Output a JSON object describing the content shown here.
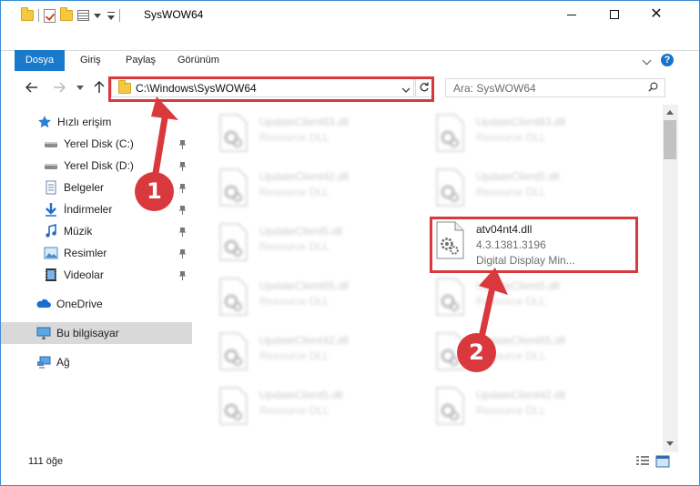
{
  "window": {
    "title": "SysWOW64",
    "buttons": {
      "minimize": "–",
      "maximize": "☐",
      "close": "✕"
    }
  },
  "ribbon": {
    "tabs": [
      "Dosya",
      "Giriş",
      "Paylaş",
      "Görünüm"
    ],
    "help_label": "?"
  },
  "navbar": {
    "address": "C:\\Windows\\SysWOW64",
    "search_placeholder": "Ara: SysWOW64"
  },
  "sidebar": {
    "items": [
      {
        "label": "Hızlı erişim",
        "icon": "star-icon",
        "pinned": false
      },
      {
        "label": "Yerel Disk (C:)",
        "icon": "drive-icon",
        "pinned": true
      },
      {
        "label": "Yerel Disk (D:)",
        "icon": "drive-icon",
        "pinned": true
      },
      {
        "label": "Belgeler",
        "icon": "documents-icon",
        "pinned": true
      },
      {
        "label": "İndirmeler",
        "icon": "download-icon",
        "pinned": true
      },
      {
        "label": "Müzik",
        "icon": "music-icon",
        "pinned": true
      },
      {
        "label": "Resimler",
        "icon": "pictures-icon",
        "pinned": true
      },
      {
        "label": "Videolar",
        "icon": "videos-icon",
        "pinned": true
      },
      {
        "label": "OneDrive",
        "icon": "cloud-icon",
        "pinned": false
      },
      {
        "label": "Bu bilgisayar",
        "icon": "computer-icon",
        "pinned": false
      },
      {
        "label": "Ağ",
        "icon": "network-icon",
        "pinned": false
      }
    ]
  },
  "files": {
    "col1": [
      {
        "name": "UpdateClient63.dll",
        "type": "Resource DLL"
      },
      {
        "name": "UpdateClient42.dll",
        "type": "Resource DLL"
      },
      {
        "name": "UpdateClient5.dll",
        "type": "Resource DLL"
      },
      {
        "name": "UpdateClient65.dll",
        "type": "Resource DLL"
      },
      {
        "name": "UpdateClient42.dll",
        "type": "Resource DLL"
      },
      {
        "name": "UpdateClient5.dll",
        "type": "Resource DLL"
      }
    ],
    "col2": [
      {
        "name": "UpdateClient63.dll",
        "type": "Resource DLL"
      },
      {
        "name": "UpdateClient5.dll",
        "type": "Resource DLL"
      },
      {
        "name": "UpdateClient5.dll",
        "type": "Resource DLL"
      },
      {
        "name": "UpdateClient65.dll",
        "type": "Resource DLL"
      },
      {
        "name": "UpdateClient42.dll",
        "type": "Resource DLL"
      }
    ],
    "highlighted": {
      "name": "atv04nt4.dll",
      "version": "4.3.1381.3196",
      "description": "Digital Display Min..."
    }
  },
  "status": {
    "item_count": "111 öğe"
  },
  "annotations": {
    "step1": "1",
    "step2": "2",
    "accent_color": "#d9393d"
  }
}
